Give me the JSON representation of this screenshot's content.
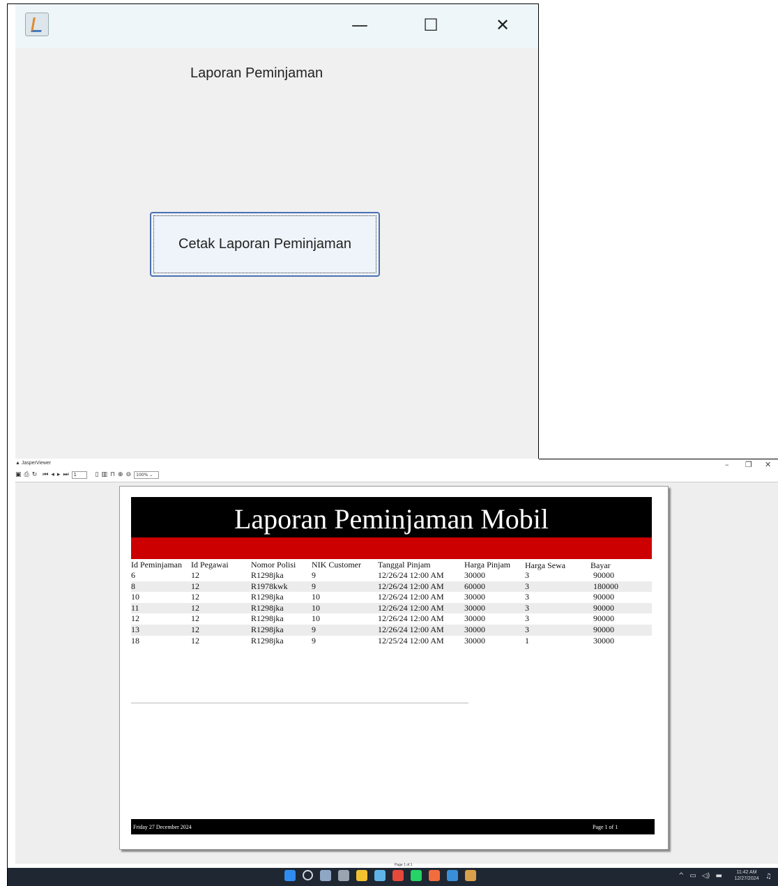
{
  "java_window": {
    "heading": "Laporan Peminjaman",
    "print_button": "Cetak Laporan Peminjaman",
    "minimize_glyph": "—",
    "maximize_glyph": "☐",
    "close_glyph": "✕"
  },
  "jasper": {
    "window_title": "JasperViewer",
    "page_field": "1",
    "zoom": "100%",
    "page_indicator": "Page 1 of 1",
    "minimize_glyph": "–",
    "restore_glyph": "❐",
    "close_glyph": "✕"
  },
  "report": {
    "title": "Laporan Peminjaman Mobil",
    "headers": [
      "Id Peminjaman",
      "Id Pegawai",
      "Nomor Polisi",
      "NIK Customer",
      "Tanggal Pinjam",
      "Harga Pinjam",
      "Harga Sewa",
      "Bayar"
    ],
    "rows": [
      [
        "6",
        "12",
        "R1298jka",
        "9",
        "12/26/24 12:00 AM",
        "30000",
        "3",
        "90000"
      ],
      [
        "8",
        "12",
        "R1978kwk",
        "9",
        "12/26/24 12:00 AM",
        "60000",
        "3",
        "180000"
      ],
      [
        "10",
        "12",
        "R1298jka",
        "10",
        "12/26/24 12:00 AM",
        "30000",
        "3",
        "90000"
      ],
      [
        "11",
        "12",
        "R1298jka",
        "10",
        "12/26/24 12:00 AM",
        "30000",
        "3",
        "90000"
      ],
      [
        "12",
        "12",
        "R1298jka",
        "10",
        "12/26/24 12:00 AM",
        "30000",
        "3",
        "90000"
      ],
      [
        "13",
        "12",
        "R1298jka",
        "9",
        "12/26/24 12:00 AM",
        "30000",
        "3",
        "90000"
      ],
      [
        "18",
        "12",
        "R1298jka",
        "9",
        "12/25/24 12:00 AM",
        "30000",
        "1",
        "30000"
      ]
    ],
    "footer_date": "Friday 27 December 2024",
    "footer_page": "Page 1 of 1"
  },
  "taskbar": {
    "time": "11:42 AM",
    "date": "12/27/2024",
    "icons": [
      "windows-start",
      "search",
      "task-view",
      "settings",
      "file-explorer",
      "copilot",
      "chrome",
      "whatsapp",
      "xampp",
      "netbeans",
      "java"
    ],
    "icon_colors": [
      "#2f8cf0",
      "#cfd6de",
      "#8fa7c4",
      "#9aa4b0",
      "#f2c230",
      "#5fb3e8",
      "#e5493a",
      "#25d366",
      "#f26d3d",
      "#3a8fd9",
      "#d8a04a"
    ]
  },
  "colors": {
    "report_title_bg": "#000000",
    "report_band_red": "#cc0000",
    "java_titlebar": "#eef6f9",
    "taskbar_bg": "#1f2733"
  }
}
